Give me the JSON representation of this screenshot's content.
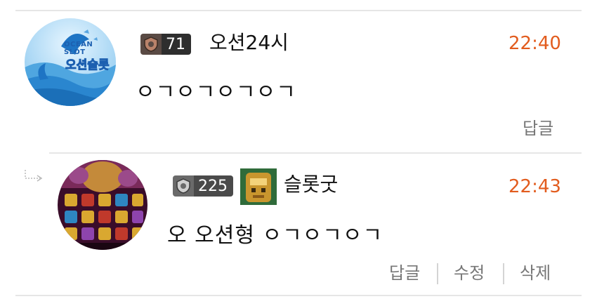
{
  "colors": {
    "time": "#e25c1e",
    "action": "#777777",
    "divider": "#e6e6e6"
  },
  "comments": [
    {
      "avatar_text_top": "OCEAN SLOT",
      "avatar_text_main": "오션슬롯",
      "level": "71",
      "nickname": "오션24시",
      "time": "22:40",
      "text": "ㅇㄱㅇㄱㅇㄱㅇㄱ",
      "actions": [
        "답글"
      ]
    },
    {
      "level": "225",
      "nickname": "슬롯굿",
      "time": "22:43",
      "text": "오 오션형 ㅇㄱㅇㄱㅇㄱ",
      "actions": [
        "답글",
        "수정",
        "삭제"
      ]
    }
  ],
  "icons": {
    "level": "shield-level-icon",
    "reply_indicator": "reply-arrow-icon",
    "user_badge": "golden-idol-badge-icon"
  }
}
